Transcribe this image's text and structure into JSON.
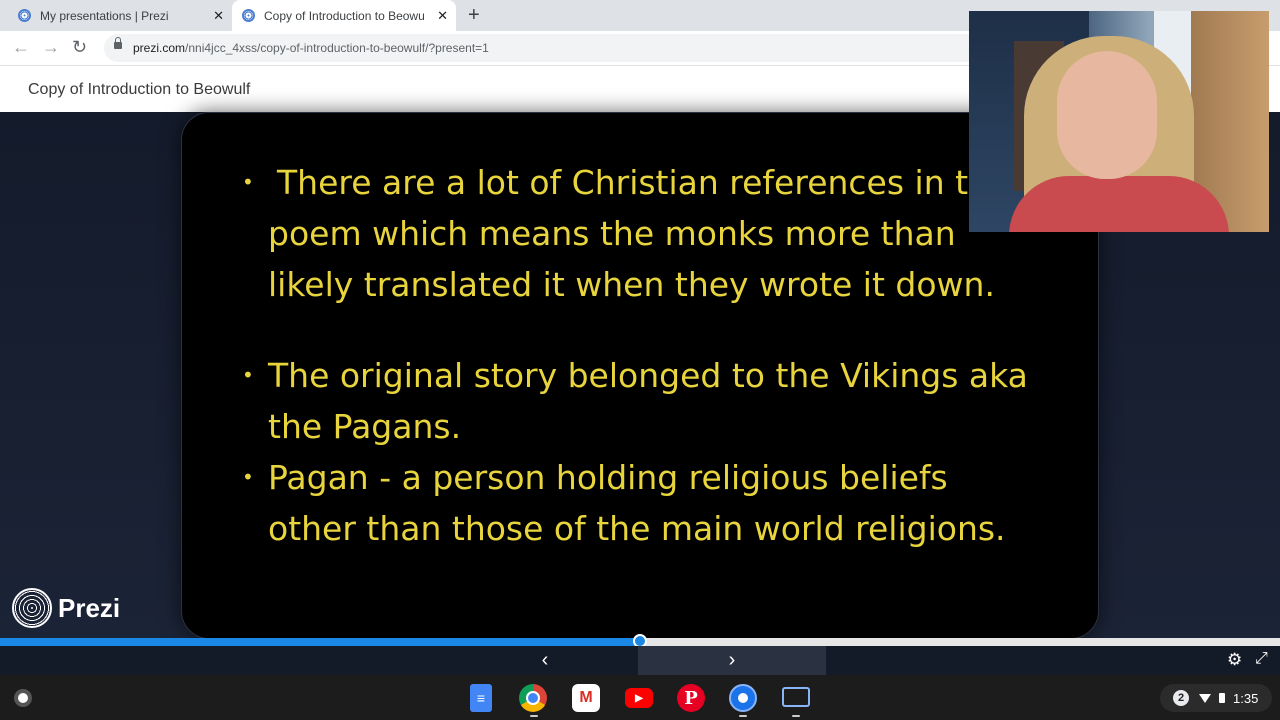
{
  "browser": {
    "tabs": [
      {
        "title": "My presentations | Prezi",
        "close": "✕"
      },
      {
        "title": "Copy of Introduction to Beowulf",
        "close": "✕"
      }
    ],
    "new_tab": "+",
    "url_host": "prezi.com",
    "url_path": "/nni4jcc_4xss/copy-of-introduction-to-beowulf/?present=1"
  },
  "prezi": {
    "title": "Copy of Introduction to Beowulf",
    "logo_text": "Prezi",
    "progress": 0.5,
    "prev": "‹",
    "next": "›",
    "settings": "⚙",
    "fullscreen": "⤢"
  },
  "slide": {
    "bullets": [
      {
        "lines": [
          "There are a lot of Christian references in the",
          "poem which means the monks more than",
          "likely translated it when they wrote it down."
        ]
      },
      {
        "lines": [
          "The original story belonged to the Vikings aka",
          "the Pagans."
        ]
      },
      {
        "lines": [
          "Pagan - a person holding religious beliefs",
          "other than those of the main world religions."
        ]
      }
    ],
    "text_color": "#e8d43c"
  },
  "shelf": {
    "apps": [
      "docs-icon",
      "chrome-icon",
      "gmail-icon",
      "youtube-icon",
      "pinterest-icon",
      "screencast-icon",
      "meet-icon"
    ],
    "notifications": "2",
    "time": "1:35"
  },
  "colors": {
    "accent": "#1b87e6"
  }
}
